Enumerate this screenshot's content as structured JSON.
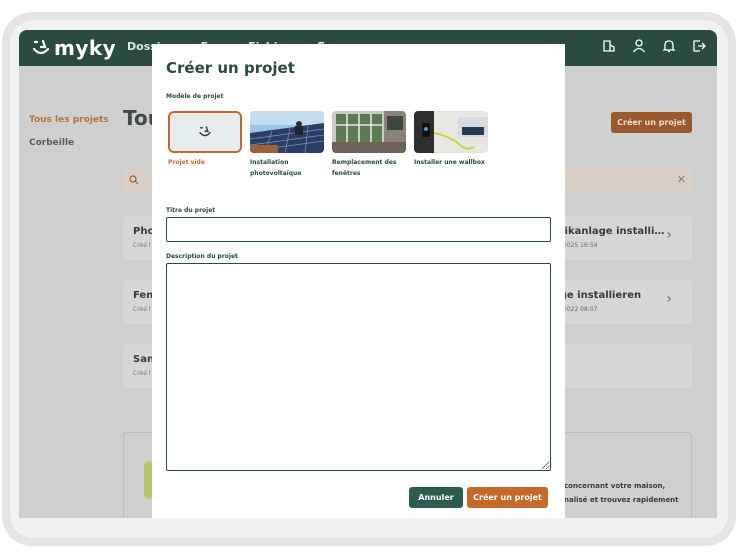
{
  "app": {
    "brand": "myky",
    "nav": [
      "Dossi",
      "E",
      "Fichi",
      "E"
    ]
  },
  "sidebar": {
    "items": [
      {
        "label": "Tous les projets"
      },
      {
        "label": "Corbeille"
      }
    ]
  },
  "background": {
    "page_title": "Tou",
    "create_button": "Créer un projet",
    "cards": [
      {
        "title": "Phot",
        "sub": "Créé l",
        "right_title": "taikanlage installi…",
        "right_sub": "2025 16:54"
      },
      {
        "title": "Fens",
        "sub": "Créé l",
        "right_title": "age installieren",
        "right_sub": "2022 08:07"
      },
      {
        "title": "Sani",
        "sub": "Créé l",
        "right_title": "",
        "right_sub": ""
      }
    ],
    "promo": {
      "line1": "concernant votre maison,",
      "line2": "nalisé et trouvez rapidement"
    }
  },
  "modal": {
    "title": "Créer un projet",
    "template_label": "Modèle de projet",
    "templates": [
      {
        "label": "Projet vide",
        "icon": "myky-logo-icon",
        "selected": true
      },
      {
        "label": "Installation photovoltaïque",
        "icon": "solar-panel-photo",
        "selected": false
      },
      {
        "label": "Remplacement des fenêtres",
        "icon": "windows-photo",
        "selected": false
      },
      {
        "label": "Installer une wallbox",
        "icon": "wallbox-photo",
        "selected": false
      }
    ],
    "title_field": {
      "label": "Titre du projet",
      "value": "",
      "placeholder": ""
    },
    "description_field": {
      "label": "Description du projet",
      "value": "",
      "placeholder": ""
    },
    "cancel_label": "Annuler",
    "submit_label": "Créer un projet"
  },
  "colors": {
    "primary_green": "#2b4a40",
    "accent_orange": "#c4692a",
    "cancel_green": "#2b5c4f"
  }
}
